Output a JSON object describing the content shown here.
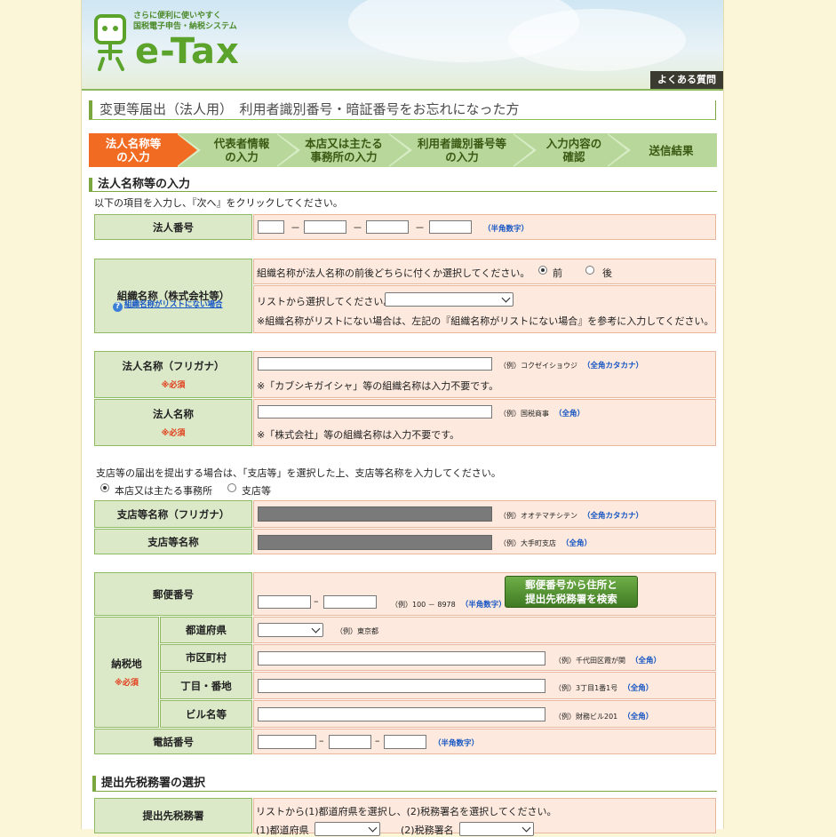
{
  "header": {
    "tagline_1": "さらに便利に使いやすく",
    "tagline_2": "国税電子申告・納税システム",
    "logo": "e-Tax",
    "faq": "よくある質問"
  },
  "page_title": "変更等届出（法人用）　利用者識別番号・暗証番号をお忘れになった方",
  "steps": [
    {
      "l1": "法人名称等",
      "l2": "の入力"
    },
    {
      "l1": "代表者情報",
      "l2": "の入力"
    },
    {
      "l1": "本店又は主たる",
      "l2": "事務所の入力"
    },
    {
      "l1": "利用者識別番号等",
      "l2": "の入力"
    },
    {
      "l1": "入力内容の",
      "l2": "確認"
    },
    {
      "l1": "送信結果",
      "l2": ""
    }
  ],
  "section1": {
    "title": "法人名称等の入力",
    "instruction": "以下の項目を入力し、『次へ』をクリックしてください。"
  },
  "corp_number": {
    "label": "法人番号",
    "kind": "（半角数字）",
    "dash": "－"
  },
  "org": {
    "label": "組織名称（株式会社等）",
    "link": "組織名称がリストにない場合",
    "position_q": "組織名称が法人名称の前後どちらに付くか選択してください。",
    "before": "前",
    "after": "後",
    "list_q": "リストから選択してください。",
    "note": "※組織名称がリストにない場合は、左記の『組織名称がリストにない場合』を参考に入力してください。"
  },
  "kana": {
    "label": "法人名称（フリガナ）",
    "required": "※必須",
    "example": "（例）コクゼイショウジ",
    "kind": "（全角カタカナ）",
    "note": "※「カブシキガイシャ」等の組織名称は入力不要です。"
  },
  "name": {
    "label": "法人名称",
    "required": "※必須",
    "example": "（例）国税商事",
    "kind": "（全角）",
    "note": "※「株式会社」等の組織名称は入力不要です。"
  },
  "branch": {
    "note": "支店等の届出を提出する場合は、「支店等」を選択した上、支店等名称を入力してください。",
    "head_office": "本店又は主たる事務所",
    "branch": "支店等",
    "kana_label": "支店等名称（フリガナ）",
    "kana_example": "（例）オオテマチシテン",
    "kana_kind": "（全角カタカナ）",
    "name_label": "支店等名称",
    "name_example": "（例）大手町支店",
    "name_kind": "（全角）"
  },
  "address": {
    "postal_label": "郵便番号",
    "postal_example": "（例）100 － 8978",
    "postal_kind": "（半角数字）",
    "search_btn_1": "郵便番号から住所と",
    "search_btn_2": "提出先税務署を検索",
    "tax_place": "納税地",
    "required": "※必須",
    "pref_label": "都道府県",
    "pref_example": "（例）東京都",
    "city_label": "市区町村",
    "city_example": "（例）千代田区霞が関",
    "city_kind": "（全角）",
    "block_label": "丁目・番地",
    "block_example": "（例）3丁目1番1号",
    "block_kind": "（全角）",
    "bldg_label": "ビル名等",
    "bldg_example": "（例）財務ビル201",
    "bldg_kind": "（全角）",
    "tel_label": "電話番号",
    "tel_kind": "（半角数字）"
  },
  "section2": {
    "title": "提出先税務署の選択",
    "label": "提出先税務署",
    "instruction": "リストから(1)都道府県を選択し、(2)税務署名を選択してください。",
    "pref": "(1)都道府県",
    "office": "(2)税務署名"
  }
}
